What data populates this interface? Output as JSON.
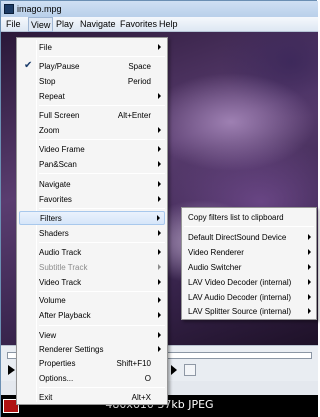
{
  "window": {
    "title": "imago.mpg"
  },
  "menubar": [
    {
      "label": "File"
    },
    {
      "label": "View"
    },
    {
      "label": "Play"
    },
    {
      "label": "Navigate"
    },
    {
      "label": "Favorites"
    },
    {
      "label": "Help"
    }
  ],
  "context_menu": [
    {
      "label": "File",
      "submenu": true
    },
    {
      "label": "Play/Pause",
      "accel": "Space",
      "checked": true
    },
    {
      "label": "Stop",
      "accel": "Period"
    },
    {
      "label": "Repeat",
      "submenu": true
    },
    {
      "label": "Full Screen",
      "accel": "Alt+Enter"
    },
    {
      "label": "Zoom",
      "submenu": true
    },
    {
      "label": "Video Frame",
      "submenu": true
    },
    {
      "label": "Pan&Scan",
      "submenu": true
    },
    {
      "label": "Navigate",
      "submenu": true
    },
    {
      "label": "Favorites",
      "submenu": true
    },
    {
      "label": "Filters",
      "submenu": true,
      "highlighted": true
    },
    {
      "label": "Shaders",
      "submenu": true
    },
    {
      "label": "Audio Track",
      "submenu": true
    },
    {
      "label": "Subtitle Track",
      "submenu": true,
      "disabled": true
    },
    {
      "label": "Video Track",
      "submenu": true
    },
    {
      "label": "Volume",
      "submenu": true
    },
    {
      "label": "After Playback",
      "submenu": true
    },
    {
      "label": "View",
      "submenu": true
    },
    {
      "label": "Renderer Settings",
      "submenu": true
    },
    {
      "label": "Properties",
      "accel": "Shift+F10"
    },
    {
      "label": "Options...",
      "accel": "O"
    },
    {
      "label": "Exit",
      "accel": "Alt+X"
    }
  ],
  "filters_submenu": [
    {
      "label": "Copy filters list to clipboard"
    },
    {
      "label": "Default DirectSound Device",
      "submenu": true
    },
    {
      "label": "Video Renderer",
      "submenu": true
    },
    {
      "label": "Audio Switcher",
      "submenu": true
    },
    {
      "label": "LAV Video Decoder (internal)",
      "submenu": true
    },
    {
      "label": "LAV Audio Decoder (internal)",
      "submenu": true
    },
    {
      "label": "LAV Splitter Source (internal)",
      "submenu": true
    }
  ],
  "footer": {
    "text": "480x610 37kb JPEG"
  }
}
